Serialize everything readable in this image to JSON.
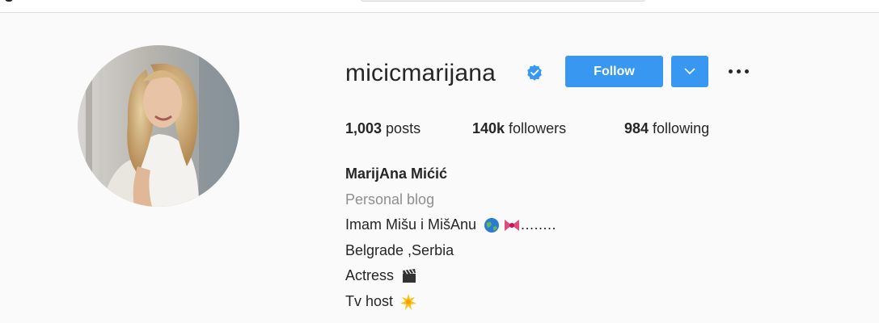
{
  "profile": {
    "username": "micicmarijana",
    "follow_label": "Follow",
    "stats": {
      "posts_count": "1,003",
      "posts_label": " posts",
      "followers_count": "140k",
      "followers_label": " followers",
      "following_count": "984",
      "following_label": " following"
    },
    "bio": {
      "full_name": "MarijAna Mićić",
      "category": "Personal blog",
      "line1_text": "Imam Mišu i MišAnu",
      "line1_tail": "........",
      "line2": "Belgrade ,Serbia",
      "line3": "Actress",
      "line4": "Tv host"
    }
  },
  "icons": {
    "verified": "verified-badge-icon",
    "dropdown": "chevron-down-icon",
    "more": "more-options-icon",
    "globe": "globe-emoji",
    "ribbon": "ribbon-emoji",
    "clapper": "clapper-board-emoji",
    "sparkle": "glowing-star-emoji"
  },
  "colors": {
    "accent": "#3897f0",
    "background": "#fafafa",
    "text": "#262626",
    "secondary_text": "#8e8e8e"
  }
}
